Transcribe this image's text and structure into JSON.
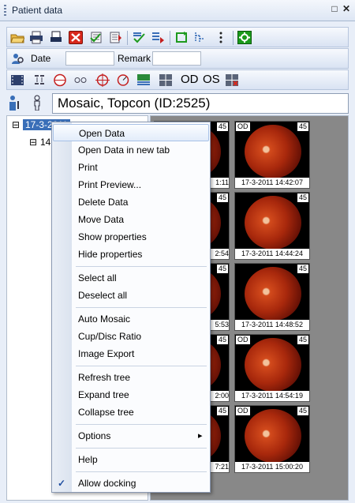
{
  "window": {
    "title": "Patient data",
    "pin_glyph": "□",
    "close_glyph": "✕"
  },
  "search": {
    "date_label": "Date",
    "date_value": "",
    "remark_label": "Remark",
    "remark_value": ""
  },
  "patient": {
    "name_display": "Mosaic, Topcon  (ID:2525)"
  },
  "tree": {
    "root_label": "17-3-2011",
    "child_label": "14",
    "expand_glyph": "⊟"
  },
  "toolbar3": {
    "od_label": "OD",
    "os_label": "OS"
  },
  "thumbnails": [
    {
      "eye": "OD",
      "angle": "45",
      "caption": "17-3-2011 14:42:07"
    },
    {
      "eye": "",
      "angle": "45",
      "caption": "17-3-2011 14:44:24"
    },
    {
      "eye": "",
      "angle": "45",
      "caption": "17-3-2011 14:48:52"
    },
    {
      "eye": "OD",
      "angle": "45",
      "caption": "17-3-2011 14:54:19"
    },
    {
      "eye": "OD",
      "angle": "45",
      "caption": "17-3-2011 15:00:20"
    }
  ],
  "hidden_thumb_captions": [
    "1:11",
    "2:54",
    "5:53",
    "2:00",
    "7:21"
  ],
  "hidden_thumb_angle": "45",
  "context_menu": {
    "items": [
      {
        "label": "Open Data"
      },
      {
        "label": "Open Data in new tab"
      },
      {
        "label": "Print"
      },
      {
        "label": "Print Preview..."
      },
      {
        "label": "Delete Data"
      },
      {
        "label": "Move Data"
      },
      {
        "label": "Show properties"
      },
      {
        "label": "Hide properties"
      },
      {
        "label": "Select all"
      },
      {
        "label": "Deselect all"
      },
      {
        "label": "Auto Mosaic"
      },
      {
        "label": "Cup/Disc Ratio"
      },
      {
        "label": "Image Export"
      },
      {
        "label": "Refresh tree"
      },
      {
        "label": "Expand tree"
      },
      {
        "label": "Collapse tree"
      },
      {
        "label": "Options",
        "submenu_glyph": "▸"
      },
      {
        "label": "Help"
      },
      {
        "label": "Allow docking",
        "check_glyph": "✓"
      }
    ]
  },
  "colors": {
    "accent": "#3a6fb8",
    "close_red": "#d8281c",
    "settings_green": "#1a9a1a"
  },
  "icons": {
    "toolbar1": [
      "open-folder-icon",
      "print-icon",
      "print-preview-icon",
      "delete-icon",
      "select-check-icon",
      "export-icon",
      "check-arrow-icon",
      "move-icon",
      "refresh-icon",
      "tree-icon",
      "more-icon",
      "settings-icon"
    ],
    "toolbar3": [
      "video-icon",
      "alignment-icon",
      "disc-icon",
      "eyes-icon",
      "target-icon",
      "focus-icon",
      "layers-icon",
      "grid-icon"
    ]
  }
}
